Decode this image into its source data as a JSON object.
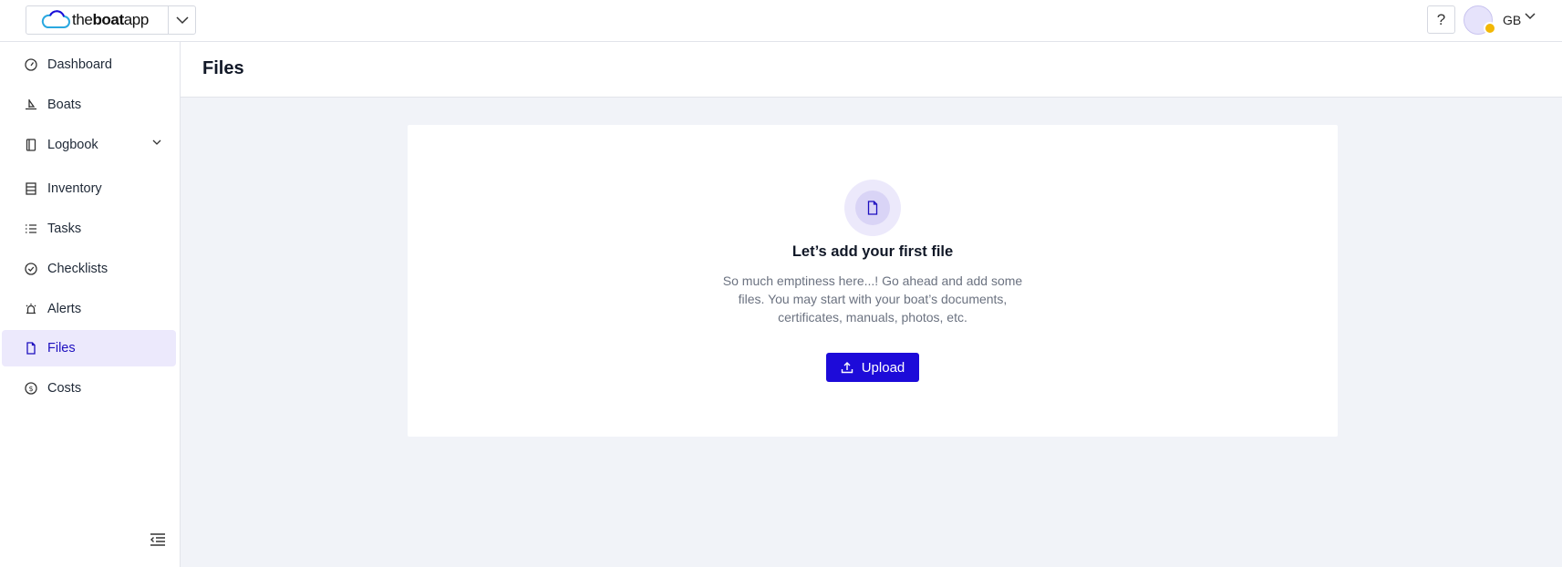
{
  "brand": {
    "name_prefix": "the",
    "name_bold": "boat",
    "name_suffix": "app"
  },
  "topbar": {
    "help_label": "?",
    "user_initials": "GB"
  },
  "sidebar": {
    "items": [
      {
        "label": "Dashboard",
        "icon": "dashboard-icon"
      },
      {
        "label": "Boats",
        "icon": "boat-icon"
      },
      {
        "label": "Logbook",
        "icon": "logbook-icon",
        "expandable": true
      },
      {
        "label": "Inventory",
        "icon": "inventory-icon"
      },
      {
        "label": "Tasks",
        "icon": "tasks-icon"
      },
      {
        "label": "Checklists",
        "icon": "checklist-icon"
      },
      {
        "label": "Alerts",
        "icon": "alert-icon"
      },
      {
        "label": "Files",
        "icon": "file-icon",
        "active": true
      },
      {
        "label": "Costs",
        "icon": "costs-icon"
      }
    ]
  },
  "header": {
    "title": "Files"
  },
  "empty_state": {
    "title": "Let’s add your first file",
    "description": "So much emptiness here...! Go ahead and add some files. You may start with your boat’s documents, certificates, manuals, photos, etc.",
    "upload_label": "Upload"
  },
  "colors": {
    "accent": "#1d0bd9",
    "active_bg": "#ece9fc",
    "page_bg": "#f1f3f8"
  }
}
